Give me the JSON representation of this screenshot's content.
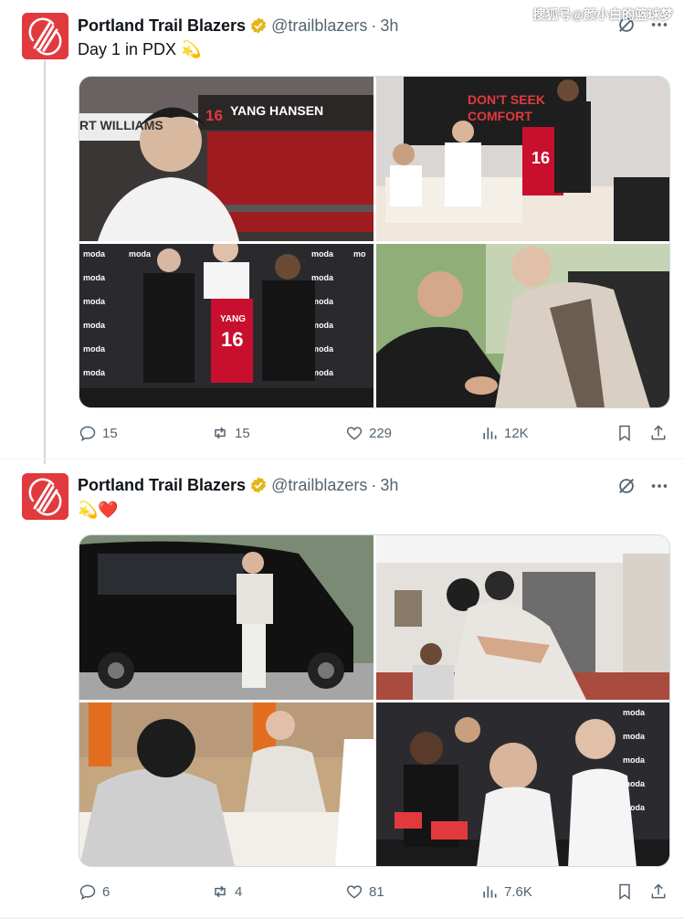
{
  "watermark": "搜狐号@颜小白的篮球梦",
  "tweets": [
    {
      "author_name": "Portland Trail Blazers",
      "handle": "@trailblazers",
      "time": "3h",
      "text": "Day 1 in PDX 💫",
      "stats": {
        "replies": "15",
        "reposts": "15",
        "likes": "229",
        "views": "12K"
      },
      "photos": [
        {
          "caption_label": "16 YANG HANSEN",
          "locker_name": "RT WILLIAMS"
        },
        {
          "sign_text": "DON'T SEEK COMFORT",
          "jersey_number": "16"
        },
        {
          "backdrop_text": "moda",
          "jersey_name": "YANG",
          "jersey_number": "16"
        },
        {}
      ]
    },
    {
      "author_name": "Portland Trail Blazers",
      "handle": "@trailblazers",
      "time": "3h",
      "text": "💫❤️",
      "stats": {
        "replies": "6",
        "reposts": "4",
        "likes": "81",
        "views": "7.6K"
      },
      "photos": [
        {},
        {},
        {},
        {
          "backdrop_text": "moda"
        }
      ]
    }
  ],
  "colors": {
    "brand": "#e03a3e",
    "verified": "#e2b719",
    "muted": "#536471",
    "text": "#0f1419"
  },
  "icons": [
    "grok-icon",
    "more-icon",
    "reply-icon",
    "repost-icon",
    "like-icon",
    "views-icon",
    "bookmark-icon",
    "share-icon",
    "verified-badge-icon"
  ]
}
